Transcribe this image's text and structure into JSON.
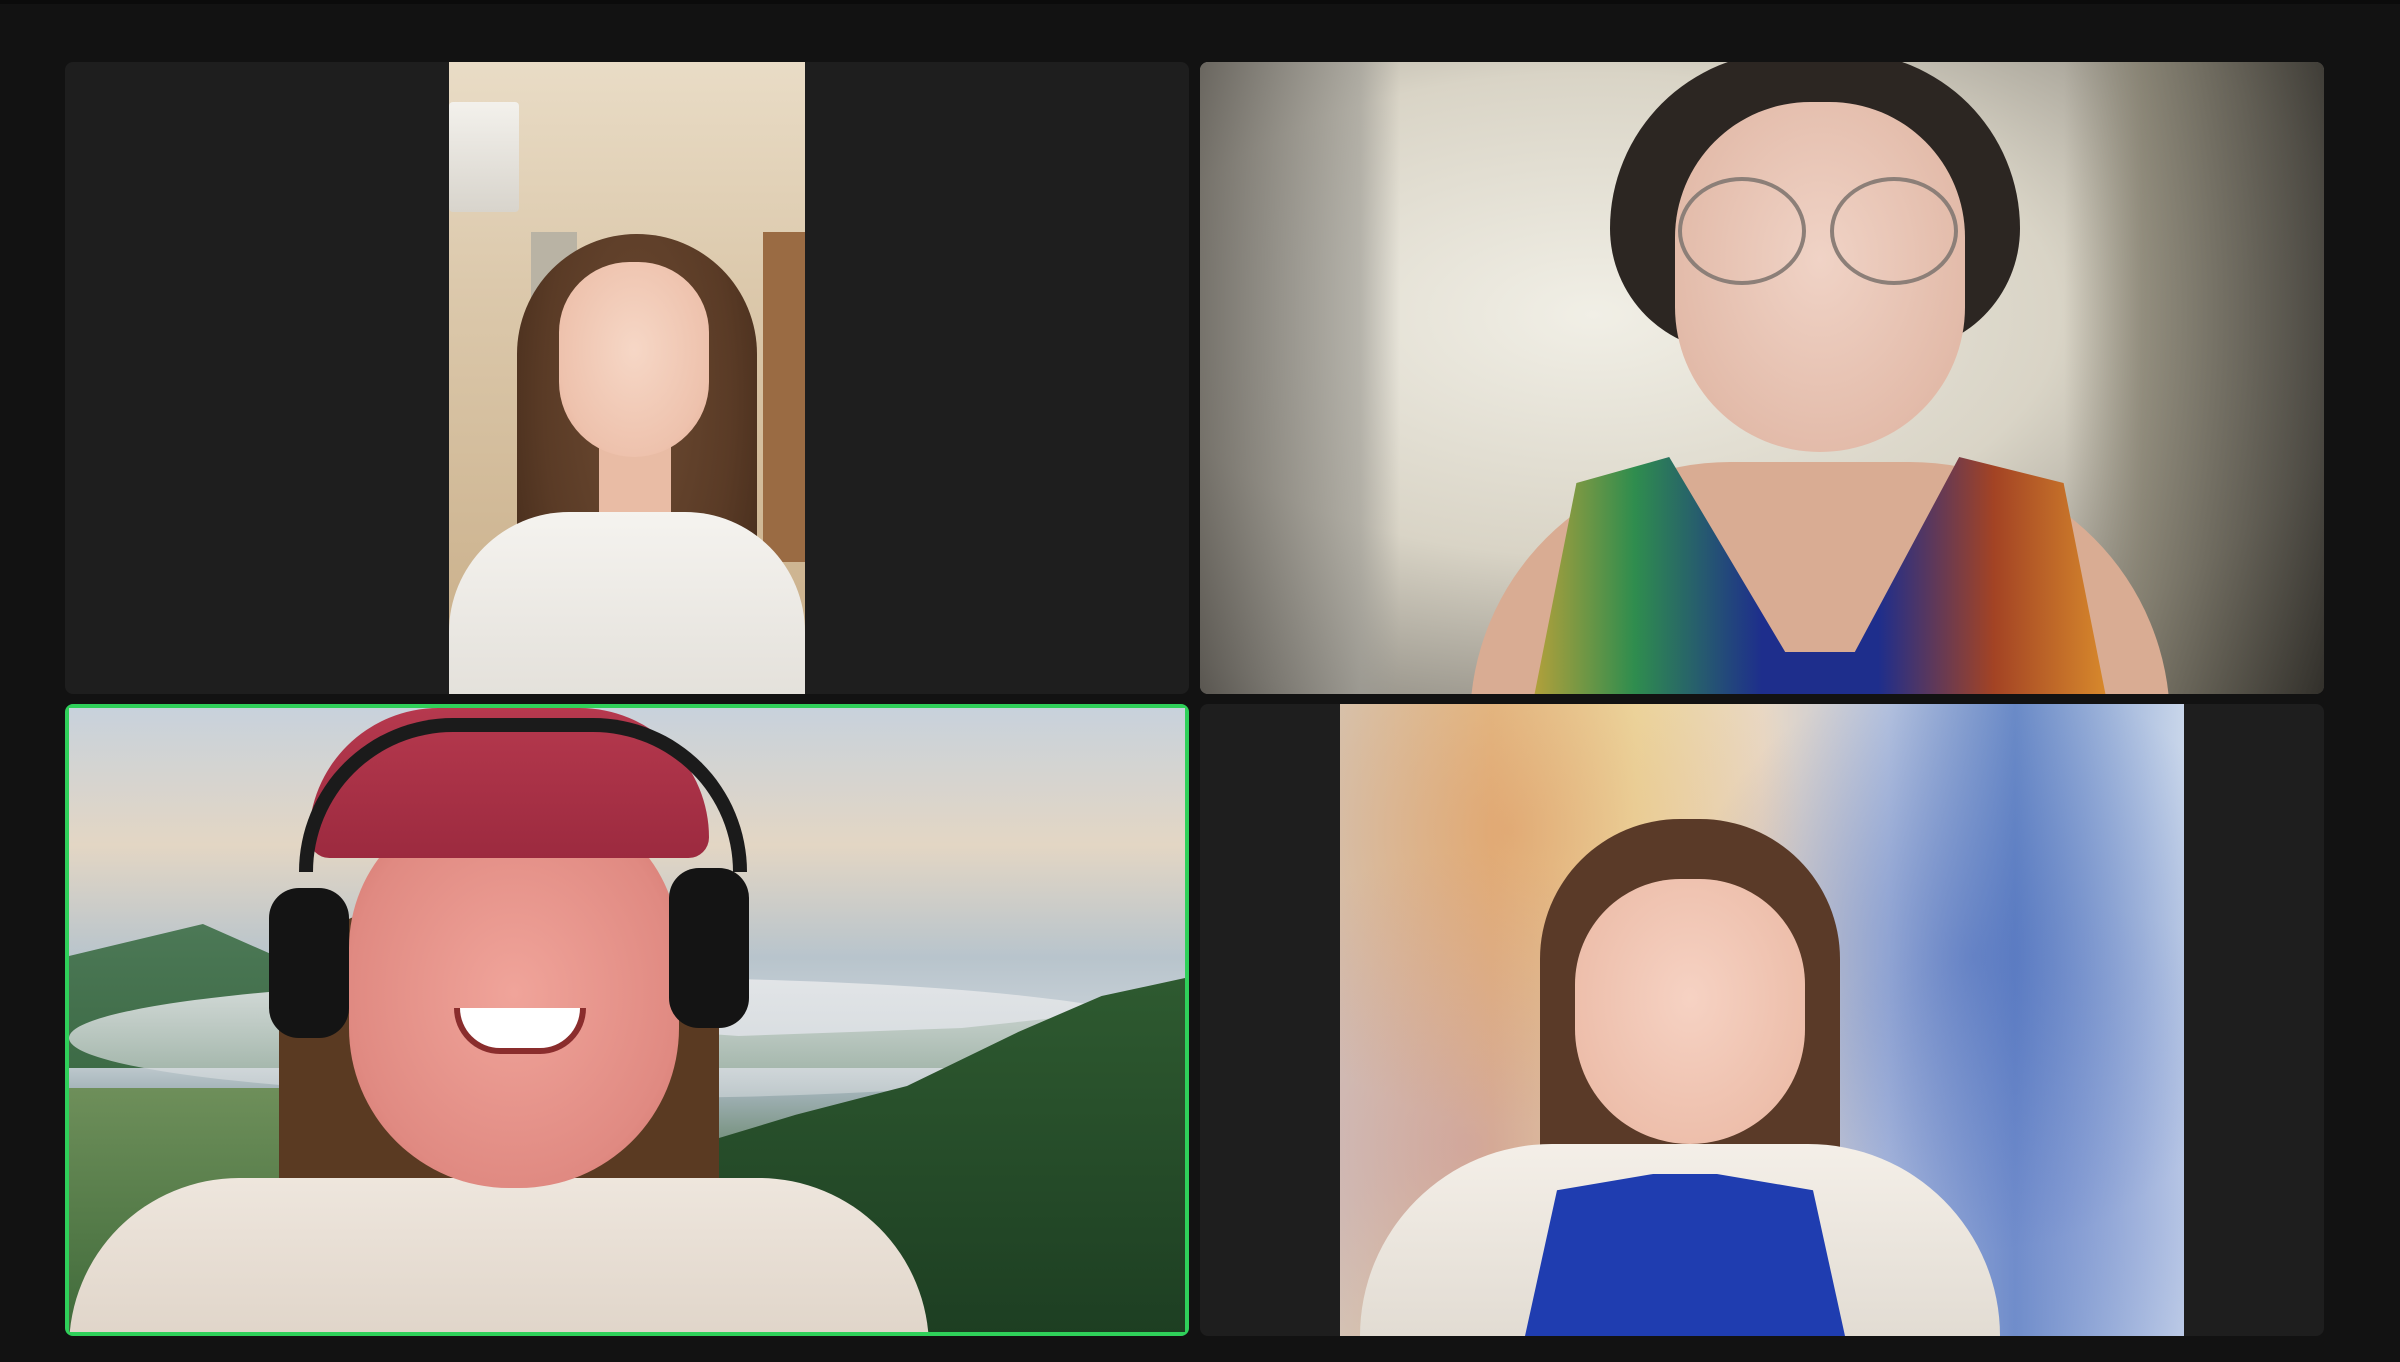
{
  "meeting": {
    "layout": "gallery-2x2",
    "active_speaker_color": "#2fd05a",
    "participants": [
      {
        "tile": 1,
        "role": "participant",
        "video_on": true,
        "active": false,
        "background": "room-interior"
      },
      {
        "tile": 2,
        "role": "participant",
        "video_on": true,
        "active": false,
        "background": "blurred"
      },
      {
        "tile": 3,
        "role": "participant",
        "video_on": true,
        "active": true,
        "background": "landscape-virtual"
      },
      {
        "tile": 4,
        "role": "participant",
        "video_on": true,
        "active": false,
        "background": "watercolor-virtual"
      }
    ]
  }
}
